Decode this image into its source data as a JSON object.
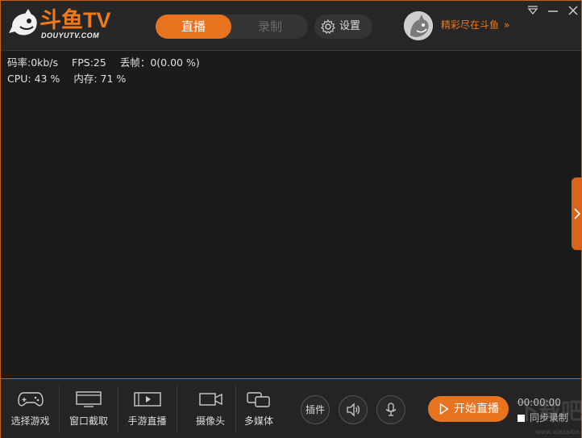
{
  "brand": {
    "logo_text": "斗鱼TV",
    "logo_sub": "DOUYUTV.COM",
    "accent": "#e8731f"
  },
  "header": {
    "mode_live": "直播",
    "mode_record": "录制",
    "settings": "设置",
    "promo": "精彩尽在斗鱼",
    "promo_chevron": "»"
  },
  "stats": {
    "bitrate": "码率:0kb/s",
    "fps": "FPS:25",
    "dropped": "丢帧：0(0.00 %)",
    "cpu": "CPU: 43 %",
    "memory": "内存: 71 %"
  },
  "toolbar": {
    "select_game": "选择游戏",
    "window_capture": "窗口截取",
    "mobile_live": "手游直播",
    "camera": "摄像头",
    "multimedia": "多媒体",
    "plugins": "插件",
    "start_live": "开始直播",
    "timer": "00:00:00",
    "sync_record": "同步录制"
  },
  "watermark": {
    "text": "下载吧",
    "sub": "www.xiazaiba.com"
  }
}
